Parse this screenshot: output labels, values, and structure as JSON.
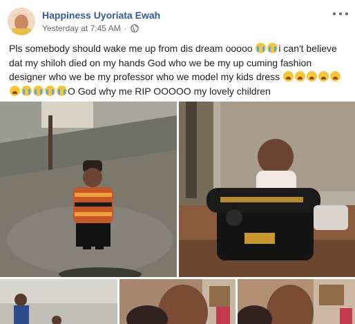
{
  "post": {
    "author_name": "Happiness Uyoriata Ewah",
    "timestamp": "Yesterday at 7:45 AM",
    "separator": "·",
    "audience_icon": "globe-icon",
    "more_icon": "more-options-icon",
    "text_segments": [
      "Pls somebody should wake me up from dis dream ooooo ",
      "i can't believe dat my shiloh died on my hands God who we be my up cuming fashion designer who we be my professor who we model my kids dress ",
      "O God why me RIP OOOOO my lovely children"
    ]
  },
  "photos": [
    {
      "subject": "child-in-kente-dress-outdoors"
    },
    {
      "subject": "child-with-sewing-machine"
    },
    {
      "subject": "child-outdoors-small"
    },
    {
      "subject": "child-closeup-1"
    },
    {
      "subject": "child-closeup-2"
    }
  ],
  "colors": {
    "author_link": "#385898",
    "meta_text": "#616770",
    "body_text": "#1c1e21"
  }
}
